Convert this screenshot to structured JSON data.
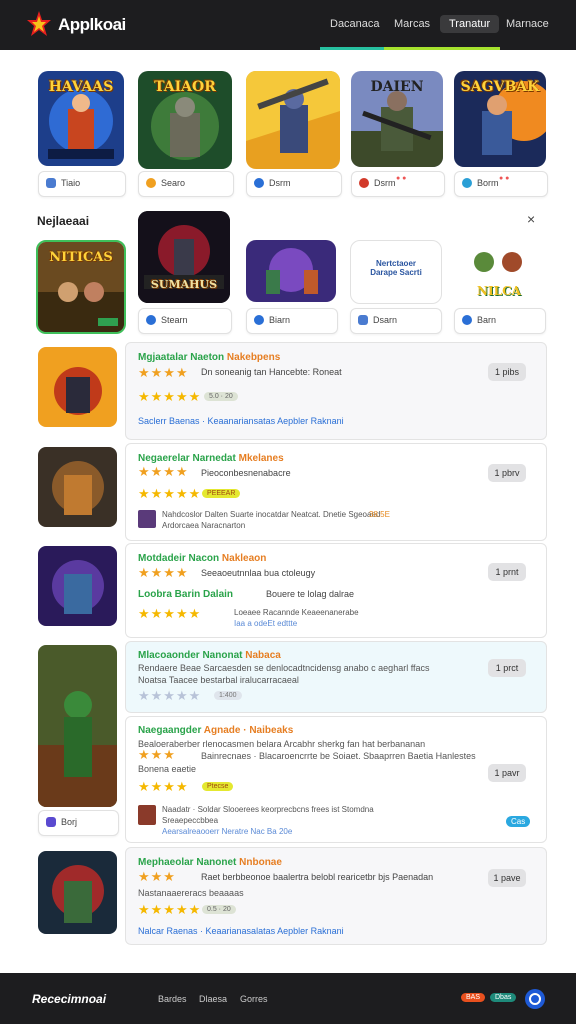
{
  "header": {
    "app_name": "Applkoai",
    "nav": [
      "Dacanaca",
      "Marcas",
      "Tranatur",
      "Marnace"
    ],
    "active_nav": 2,
    "accent_colors": [
      "#27c0a0",
      "#a6e22e"
    ]
  },
  "top_row": [
    {
      "title": "HAVAAS",
      "chip": "Tiaio",
      "icon": "user-icon",
      "icon_color": "#4a7bd0"
    },
    {
      "title": "TAIAOR",
      "chip": "Searo",
      "icon": "coin-icon",
      "icon_color": "#f0a020"
    },
    {
      "title": "",
      "chip": "Dsrm",
      "icon": "globe-icon",
      "icon_color": "#2a6fd6"
    },
    {
      "title": "DAIEN",
      "chip": "Dsrm",
      "icon": "target-icon",
      "icon_color": "#d23a2a",
      "extra": "● ●"
    },
    {
      "title": "SAGVBAK",
      "chip": "Borm",
      "icon": "globe-icon",
      "icon_color": "#2a9fd6",
      "extra": "● ●"
    }
  ],
  "section": {
    "title": "Nejlaeaai",
    "close_icon": "×",
    "items": [
      {
        "title": "NITICAS",
        "tag": "SE",
        "chip": ""
      },
      {
        "title": "SUMAHUS",
        "chip": "Stearn"
      },
      {
        "title": "",
        "chip": "Biarn"
      },
      {
        "title": "Nertctaoer\nDarape Sacrti",
        "chip": "Dsarn"
      },
      {
        "title": "NILCA",
        "chip": "Barn"
      }
    ]
  },
  "games": [
    {
      "name": "Mgjaatalar Naeton",
      "name_accent": "Nakebpens",
      "desc": "Dn soneanig tan Hancebte: Roneat",
      "rating_badge": "5.0 · 20",
      "meta": "Saclerr Baenas · Keaanariansatas Aepbler Raknani",
      "meta_icon": "bookmark-icon",
      "button": "1 pibs"
    },
    {
      "name": "Negaerelar Narnedat",
      "name_accent": "Mkelanes",
      "desc": "Pieoconbesnenabacre",
      "rating_badge": "PEEEAR",
      "review": "Nahdcoslor Dalten  Suarte inocatdar Neatcat. Dnetie Sgeoaed",
      "review_tag": "38.5E",
      "review_sub": "Ardorcaea Naracnarton",
      "button": "1 pbrv"
    },
    {
      "name": "Motdadeir Nacon",
      "name_accent": "Nakleaon",
      "desc": "Seeaoeutnnlaa bua ctoleugy",
      "subname": "Loobra Barin Dalain",
      "subdesc": "Bouere te lolag dalrae",
      "review": "Loeaee Racannde Keaeenanerabe",
      "review_sub": "Iaa a odeEt edttte",
      "button": "1 prnt"
    },
    {
      "name": "Mlacoaonder Nanonat",
      "name_accent": "Nabaca",
      "desc": "Rendaere Beae Sarcaesden se denlocadtncidensg anabo c aegharl ffacs Noatsa Taacee bestarbal iralucarracaeal",
      "rating_badge": "1:400",
      "button": "1 prct"
    },
    {
      "name": "Naegaangder",
      "name_accent": "Agnade · Naibeaks",
      "desc": "Bealoeraberber rlenocasmen belara Arcabhr sherkg fan hat berbananan",
      "desc_line2": "Bainrecnaes · Blacaroencrrte be Soiaet. Sbaaprren Baetia Hanlestes",
      "desc_line3": "Bonena eaetie",
      "rating_badge": "Ptecse",
      "review": "Naadatr · Soldar Slooerees keorprecbcns frees ist Stomdna",
      "review_sub": "Sreaepeccbbea",
      "review_sub2": "Aearsalreaooerr Neratre Nac Ba 20e",
      "button": "1 pavr",
      "side_chip": "Borj",
      "blue_pill": "Cas"
    },
    {
      "name": "Mephaeolar Nanonet",
      "name_accent": "Nnbonae",
      "desc": "Raet berbbeonoe baalertra belobl rearicetbr bjs Paenadan",
      "desc_line2": "Nastanaaereracs beaaaas",
      "rating_badge": "0.5 · 20",
      "meta": "Nalcar Raenas · Keaarianasalatas Aepbler Raknani",
      "meta_icon": "bookmark-icon",
      "button": "1 pave"
    }
  ],
  "footer": {
    "title": "Rececimnoai",
    "links": [
      "Bardes",
      "Dlaesa",
      "Gorres"
    ],
    "badge_red": "BAS",
    "badge_green": "Dbas",
    "icon": "refresh-icon"
  }
}
